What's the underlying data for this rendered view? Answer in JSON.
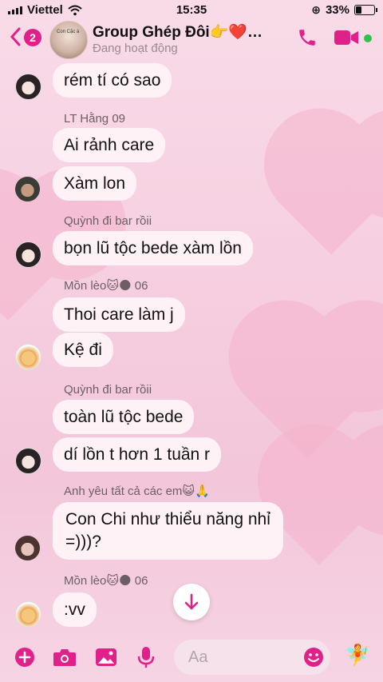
{
  "status_bar": {
    "carrier": "Viettel",
    "time": "15:35",
    "battery": "33%",
    "battery_level": 0.33
  },
  "header": {
    "back_count": "2",
    "group_name": "Group Ghép Đôi👉❤️…",
    "status": "Đang hoạt động",
    "avatar_caption": "Con Cặc à"
  },
  "messages": [
    {
      "text": "rém tí có sao"
    },
    {
      "sender": "LT Hằng 09",
      "text": "Ai rảnh care"
    },
    {
      "text": "Xàm lon"
    },
    {
      "sender": "Quỳnh đi bar rồii",
      "text": "bọn lũ tộc bede xàm lồn"
    },
    {
      "sender": "Mồn lèo🐱🌑 06",
      "text": "Thoi care làm j"
    },
    {
      "text": "Kệ đi"
    },
    {
      "sender": "Quỳnh đi bar rồii",
      "text": "toàn lũ tộc bede"
    },
    {
      "text": "dí lồn t hơn 1 tuần r"
    },
    {
      "sender": "Anh yêu tất cả các em😺🙏",
      "text_line1": "Con Chi như thiểu năng nhỉ",
      "text_line2": "=)))?"
    },
    {
      "sender": "Mồn lèo🐱🌑 06",
      "text": ":vv"
    }
  ],
  "composer": {
    "placeholder": "Aa"
  },
  "colors": {
    "accent": "#e0218a",
    "online": "#31c24d"
  }
}
